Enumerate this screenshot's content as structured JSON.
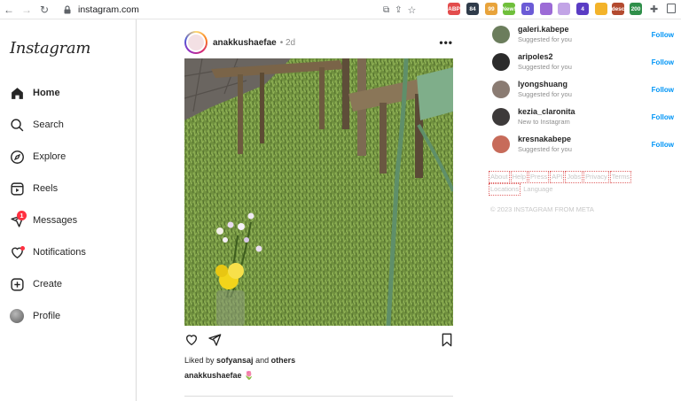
{
  "browser": {
    "url": "instagram.com",
    "extensions": [
      {
        "name": "abp-icon",
        "label": "ABP",
        "color": "#e34c4c"
      },
      {
        "name": "counter-icon",
        "label": "84",
        "color": "#2f3b4a"
      },
      {
        "name": "ext-99-icon",
        "label": "99",
        "color": "#e8a33b"
      },
      {
        "name": "new-badge-icon",
        "label": "New!",
        "color": "#6fbf3b"
      },
      {
        "name": "d-icon",
        "label": "D",
        "color": "#6b5bd6"
      },
      {
        "name": "pen-icon",
        "label": "",
        "color": "#9c6bd6"
      },
      {
        "name": "link-icon",
        "label": "",
        "color": "#c2a4e6"
      },
      {
        "name": "cube-icon",
        "label": "4",
        "color": "#5a3cc4"
      },
      {
        "name": "sun-icon",
        "label": "",
        "color": "#f3b32a"
      },
      {
        "name": "desc-icon",
        "label": "desc",
        "color": "#b34a2f"
      },
      {
        "name": "ext-200-icon",
        "label": "200",
        "color": "#2f8f4a"
      }
    ]
  },
  "sidebar": {
    "logo": "Instagram",
    "items": [
      {
        "label": "Home"
      },
      {
        "label": "Search"
      },
      {
        "label": "Explore"
      },
      {
        "label": "Reels"
      },
      {
        "label": "Messages",
        "badge": "1"
      },
      {
        "label": "Notifications"
      },
      {
        "label": "Create"
      },
      {
        "label": "Profile"
      }
    ]
  },
  "post": {
    "username": "anakkushaefae",
    "time": "• 2d",
    "more": "•••",
    "liked_prefix": "Liked by ",
    "liked_user": "sofyansaj",
    "liked_and": " and ",
    "liked_others": "others",
    "caption_user": "anakkushaefae",
    "caption_emoji": "🌷"
  },
  "suggestions": [
    {
      "name": "galeri.kabepe",
      "sub": "Suggested for you",
      "follow": "Follow",
      "color": "#6b7d5c"
    },
    {
      "name": "aripoles2",
      "sub": "Suggested for you",
      "follow": "Follow",
      "color": "#2b2b2b"
    },
    {
      "name": "lyongshuang",
      "sub": "Suggested for you",
      "follow": "Follow",
      "color": "#8a7b72"
    },
    {
      "name": "kezia_claronita",
      "sub": "New to Instagram",
      "follow": "Follow",
      "color": "#3d3a3a"
    },
    {
      "name": "kresnakabepe",
      "sub": "Suggested for you",
      "follow": "Follow",
      "color": "#c76b5a"
    }
  ],
  "footer": {
    "links": [
      "About",
      "Help",
      "Press",
      "API",
      "Jobs",
      "Privacy",
      "Terms",
      "Locations"
    ],
    "language": "Language",
    "copyright": "© 2023 INSTAGRAM FROM META"
  }
}
